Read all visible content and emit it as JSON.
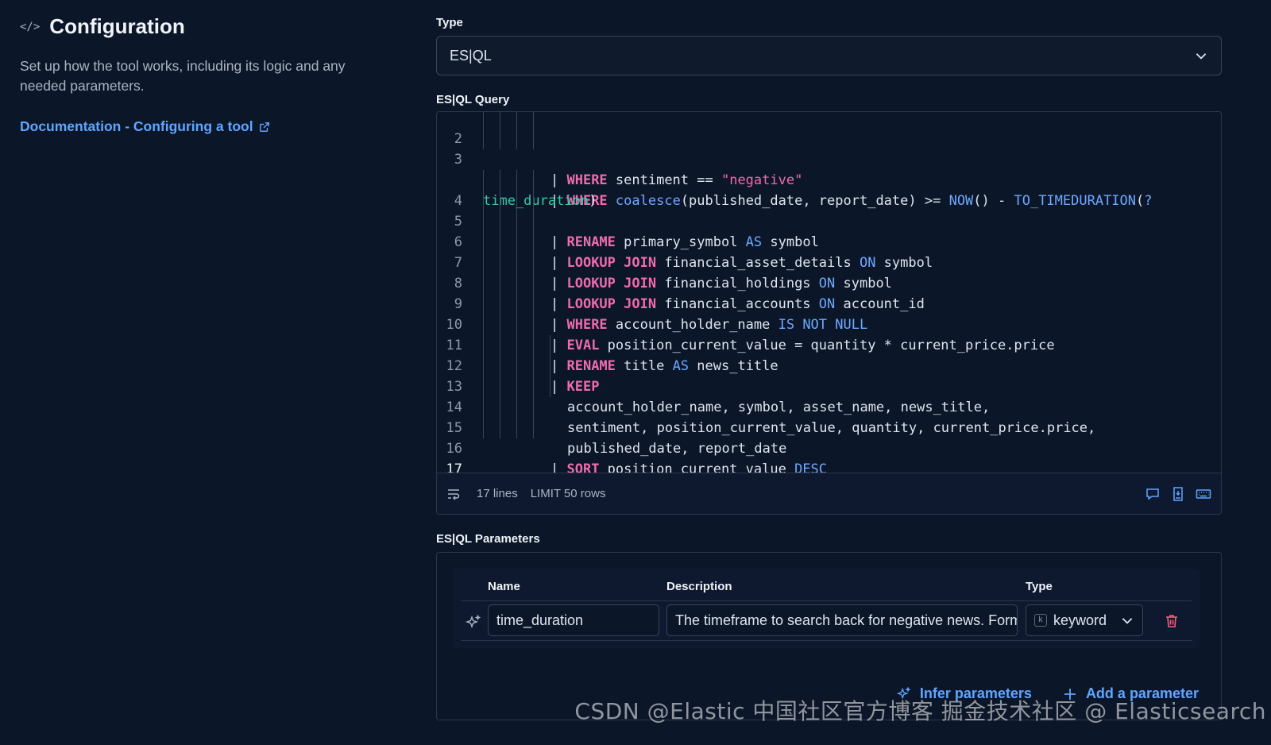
{
  "config": {
    "title": "Configuration",
    "description": "Set up how the tool works, including its logic and any needed parameters.",
    "doc_link": "Documentation - Configuring a tool"
  },
  "type_field": {
    "label": "Type",
    "value": "ES|QL"
  },
  "query": {
    "label": "ES|QL Query",
    "lines": [
      {
        "n": "2"
      },
      {
        "n": "3"
      },
      {
        "n": ""
      },
      {
        "n": "4"
      },
      {
        "n": "5"
      },
      {
        "n": "6"
      },
      {
        "n": "7"
      },
      {
        "n": "8"
      },
      {
        "n": "9"
      },
      {
        "n": "10"
      },
      {
        "n": "11"
      },
      {
        "n": "12"
      },
      {
        "n": "13"
      },
      {
        "n": "14"
      },
      {
        "n": "15"
      },
      {
        "n": "16"
      },
      {
        "n": "17"
      }
    ],
    "footer": {
      "line_count": "17 lines",
      "limit": "LIMIT 50 rows"
    }
  },
  "parameters": {
    "label": "ES|QL Parameters",
    "columns": {
      "name": "Name",
      "description": "Description",
      "type": "Type"
    },
    "rows": [
      {
        "name": "time_duration",
        "description": "The timeframe to search back for negative news. Format: X hours/days",
        "type": "keyword"
      }
    ],
    "infer_label": "Infer parameters",
    "add_label": "Add a parameter"
  },
  "watermark": "CSDN @Elastic 中国社区官方博客 掘金技术社区 @ Elasticsearch"
}
